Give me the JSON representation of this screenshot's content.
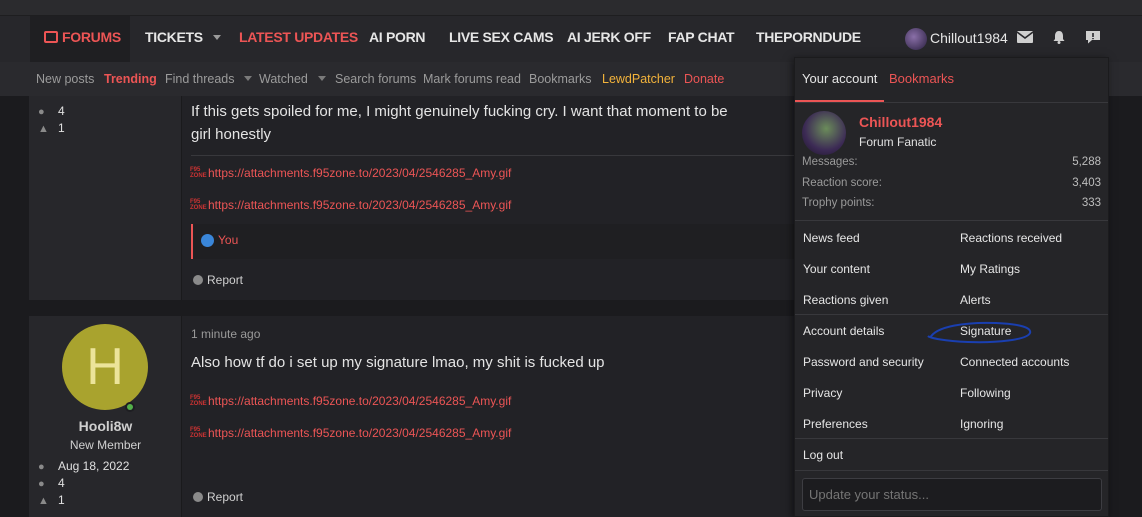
{
  "nav": {
    "items": [
      {
        "label": "FORUMS"
      },
      {
        "label": "TICKETS"
      },
      {
        "label": "LATEST UPDATES"
      },
      {
        "label": "AI PORN"
      },
      {
        "label": "LIVE SEX CAMS"
      },
      {
        "label": "AI JERK OFF"
      },
      {
        "label": "FAP CHAT"
      },
      {
        "label": "THEPORNDUDE"
      }
    ],
    "username": "Chillout1984"
  },
  "subnav": {
    "items": [
      {
        "label": "New posts"
      },
      {
        "label": "Trending"
      },
      {
        "label": "Find threads"
      },
      {
        "label": "Watched"
      },
      {
        "label": "Search forums"
      },
      {
        "label": "Mark forums read"
      },
      {
        "label": "Bookmarks"
      },
      {
        "label": "LewdPatcher"
      },
      {
        "label": "Donate"
      }
    ]
  },
  "post1": {
    "stats": [
      {
        "value": "4"
      },
      {
        "value": "1"
      }
    ],
    "message_line1": "If this gets spoiled for me, I might genuinely fucking cry. I want that moment to be",
    "message_line2": "girl honestly",
    "attachments": [
      {
        "url": "https://attachments.f95zone.to/2023/04/2546285_Amy.gif"
      },
      {
        "url": "https://attachments.f95zone.to/2023/04/2546285_Amy.gif"
      }
    ],
    "reaction_text": "You",
    "report_label": "Report"
  },
  "post2": {
    "avatar_letter": "H",
    "author": "Hooli8w",
    "author_title": "New Member",
    "joined": "Aug 18, 2022",
    "stats": [
      {
        "value": "4"
      },
      {
        "value": "1"
      }
    ],
    "time": "1 minute ago",
    "message": "Also how tf do i set up my signature lmao, my shit is fucked up",
    "attachments": [
      {
        "url": "https://attachments.f95zone.to/2023/04/2546285_Amy.gif"
      },
      {
        "url": "https://attachments.f95zone.to/2023/04/2546285_Amy.gif"
      }
    ],
    "report_label": "Report"
  },
  "account_menu": {
    "tab_account": "Your account",
    "tab_bookmarks": "Bookmarks",
    "username": "Chillout1984",
    "user_title": "Forum Fanatic",
    "stats": [
      {
        "label": "Messages:",
        "value": "5,288"
      },
      {
        "label": "Reaction score:",
        "value": "3,403"
      },
      {
        "label": "Trophy points:",
        "value": "333"
      }
    ],
    "links_left": [
      {
        "label": "News feed"
      },
      {
        "label": "Your content"
      },
      {
        "label": "Reactions given"
      },
      {
        "label": "Account details"
      },
      {
        "label": "Password and security"
      },
      {
        "label": "Privacy"
      },
      {
        "label": "Preferences"
      }
    ],
    "links_right": [
      {
        "label": "Reactions received"
      },
      {
        "label": "My Ratings"
      },
      {
        "label": "Alerts"
      },
      {
        "label": "Signature"
      },
      {
        "label": "Connected accounts"
      },
      {
        "label": "Following"
      },
      {
        "label": "Ignoring"
      }
    ],
    "logout": "Log out",
    "status_placeholder": "Update your status..."
  },
  "colors": {
    "accent": "#ec5555",
    "background": "#1b1b1e",
    "panel": "#222226",
    "highlight_scribble": "#1a3fb0"
  }
}
